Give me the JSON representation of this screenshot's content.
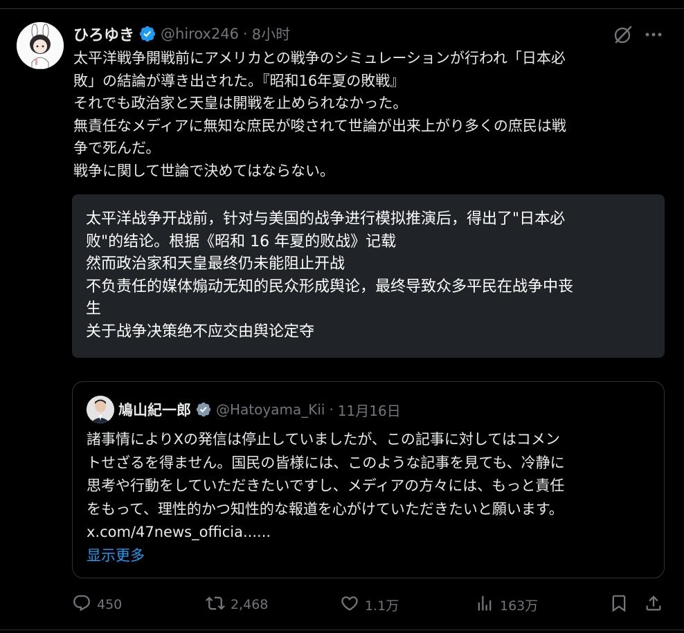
{
  "colors": {
    "background": "#000000",
    "text": "#e7e9ea",
    "muted": "#71767b",
    "accent": "#1d9bf0",
    "translation_bg": "#202327",
    "border": "#2f3336"
  },
  "post": {
    "author": {
      "name": "ひろゆき",
      "handle": "@hirox246",
      "verified_icon": "verified-badge-icon"
    },
    "separator": "·",
    "time": "8小时",
    "text_lines": [
      "太平洋戦争開戦前にアメリカとの戦争のシミュレーションが行われ「日本必",
      "敗」の結論が導き出された。『昭和16年夏の敗戦』",
      "それでも政治家と天皇は開戦を止められなかった。",
      "無責任なメディアに無知な庶民が唆されて世論が出来上がり多くの庶民は戦",
      "争で死んだ。",
      "戦争に関して世論で決めてはならない。"
    ],
    "translation_lines": [
      "太平洋战争开战前，针对与美国的战争进行模拟推演后，得出了\"日本必",
      "败\"的结论。根据《昭和 16 年夏的败战》记载",
      "然而政治家和天皇最终仍未能阻止开战",
      "不负责任的媒体煽动无知的民众形成舆论，最终导致众多平民在战争中丧",
      "生",
      "关于战争决策绝不应交由舆论定夺"
    ]
  },
  "quote": {
    "author": {
      "name": "鳩山紀一郎",
      "handle": "@Hatoyama_Kii",
      "verified_icon": "verified-badge-gray-icon"
    },
    "separator": "·",
    "time": "11月16日",
    "text_lines": [
      "諸事情によりXの発信は停止していましたが、この記事に対してはコメン",
      "トせざるを得ません。国民の皆様には、このような記事を見ても、冷静に",
      "思考や行動をしていただきたいですし、メディアの方々には、もっと責任",
      "をもって、理性的かつ知性的な報道を心がけていただきたいと願います。"
    ],
    "link": "x.com/47news_officia......",
    "show_more": "显示更多"
  },
  "actions": {
    "replies": "450",
    "reposts": "2,468",
    "likes": "1.1万",
    "views": "163万"
  }
}
